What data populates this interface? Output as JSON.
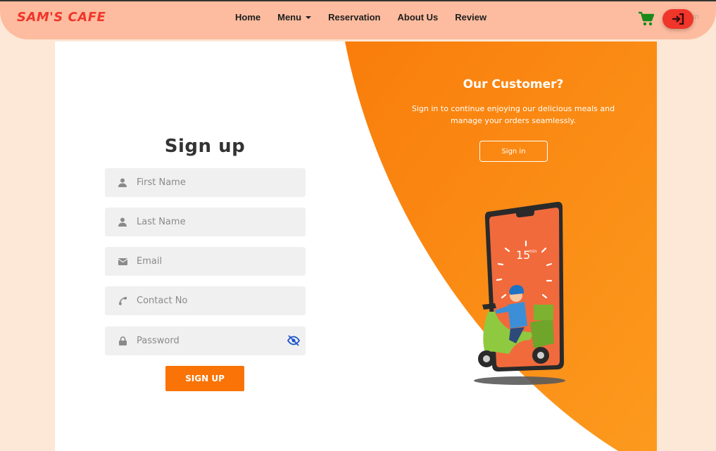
{
  "navbar": {
    "brand": "SAM'S CAFE",
    "links": [
      "Home",
      "Menu",
      "Reservation",
      "About Us",
      "Review"
    ],
    "login_ghost": "Login"
  },
  "signup": {
    "title": "Sign up",
    "fields": {
      "first_name": "First Name",
      "last_name": "Last Name",
      "email": "Email",
      "contact": "Contact No",
      "password": "Password"
    },
    "button": "SIGN UP"
  },
  "panel": {
    "title": "Our Customer?",
    "text": "Sign in to continue enjoying our delicious meals and manage your orders seamlessly.",
    "button": "Sign in",
    "timer": "15",
    "timer_unit": "min"
  },
  "colors": {
    "brand": "#f0352b",
    "accent": "#f97306",
    "navbar": "#fdbc9f",
    "cart": "#1a8a1a"
  },
  "icons": [
    "cart-icon",
    "login-icon",
    "user-icon",
    "envelope-icon",
    "phone-icon",
    "lock-icon",
    "eye-slash-icon"
  ]
}
